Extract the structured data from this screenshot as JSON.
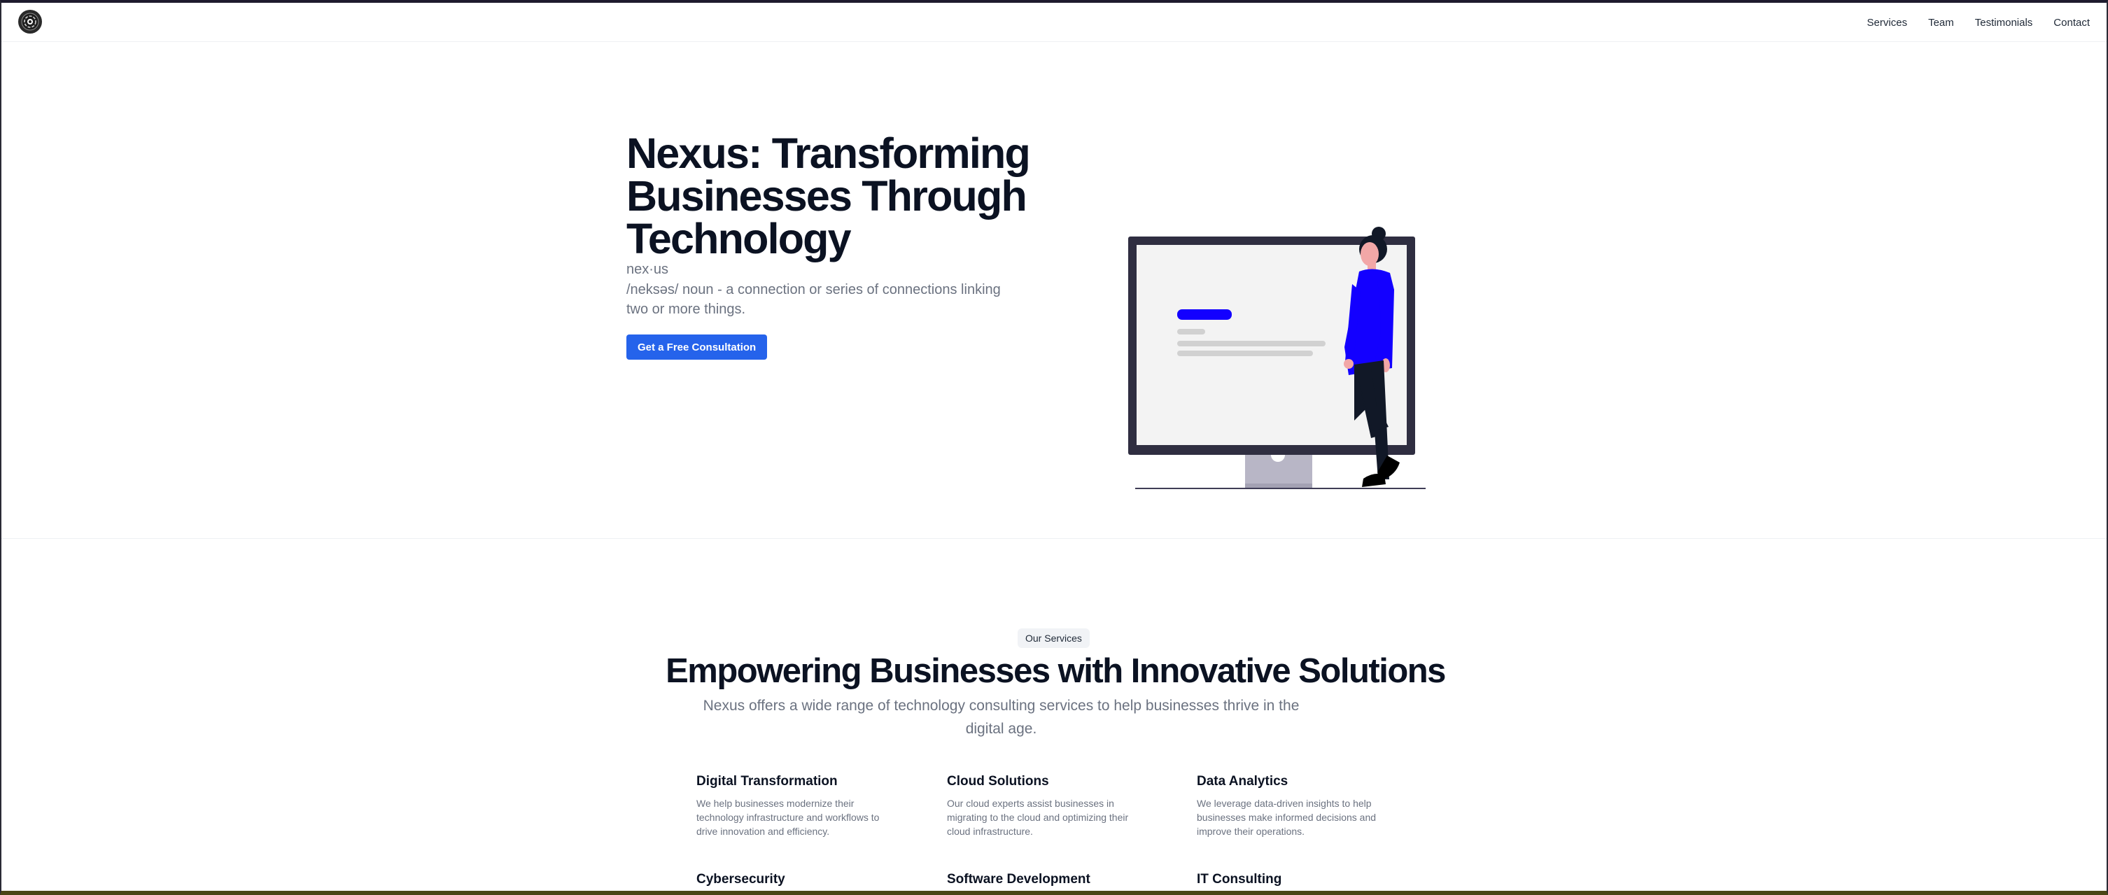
{
  "nav": {
    "logo_icon": "nexus-logo-icon",
    "links": [
      "Services",
      "Team",
      "Testimonials",
      "Contact"
    ]
  },
  "hero": {
    "title": "Nexus: Transforming Businesses Through Technology",
    "word": "nex·us",
    "definition": "/neksəs/ noun - a connection or series of connections linking two or more things.",
    "cta_label": "Get a Free Consultation",
    "illustration_icon": "person-with-monitor-illustration"
  },
  "services": {
    "badge": "Our Services",
    "title": "Empowering Businesses with Innovative Solutions",
    "subtitle": "Nexus offers a wide range of technology consulting services to help businesses thrive in the digital age.",
    "cards": [
      {
        "title": "Digital Transformation",
        "text": "We help businesses modernize their technology infrastructure and workflows to drive innovation and efficiency."
      },
      {
        "title": "Cloud Solutions",
        "text": "Our cloud experts assist businesses in migrating to the cloud and optimizing their cloud infrastructure."
      },
      {
        "title": "Data Analytics",
        "text": "We leverage data-driven insights to help businesses make informed decisions and improve their operations."
      },
      {
        "title": "Cybersecurity",
        "text": ""
      },
      {
        "title": "Software Development",
        "text": ""
      },
      {
        "title": "IT Consulting",
        "text": ""
      }
    ]
  },
  "colors": {
    "accent": "#2563eb",
    "illustration_blue": "#1300ff",
    "monitor_frame": "#2f2e41",
    "monitor_stand": "#b8b6c6"
  }
}
